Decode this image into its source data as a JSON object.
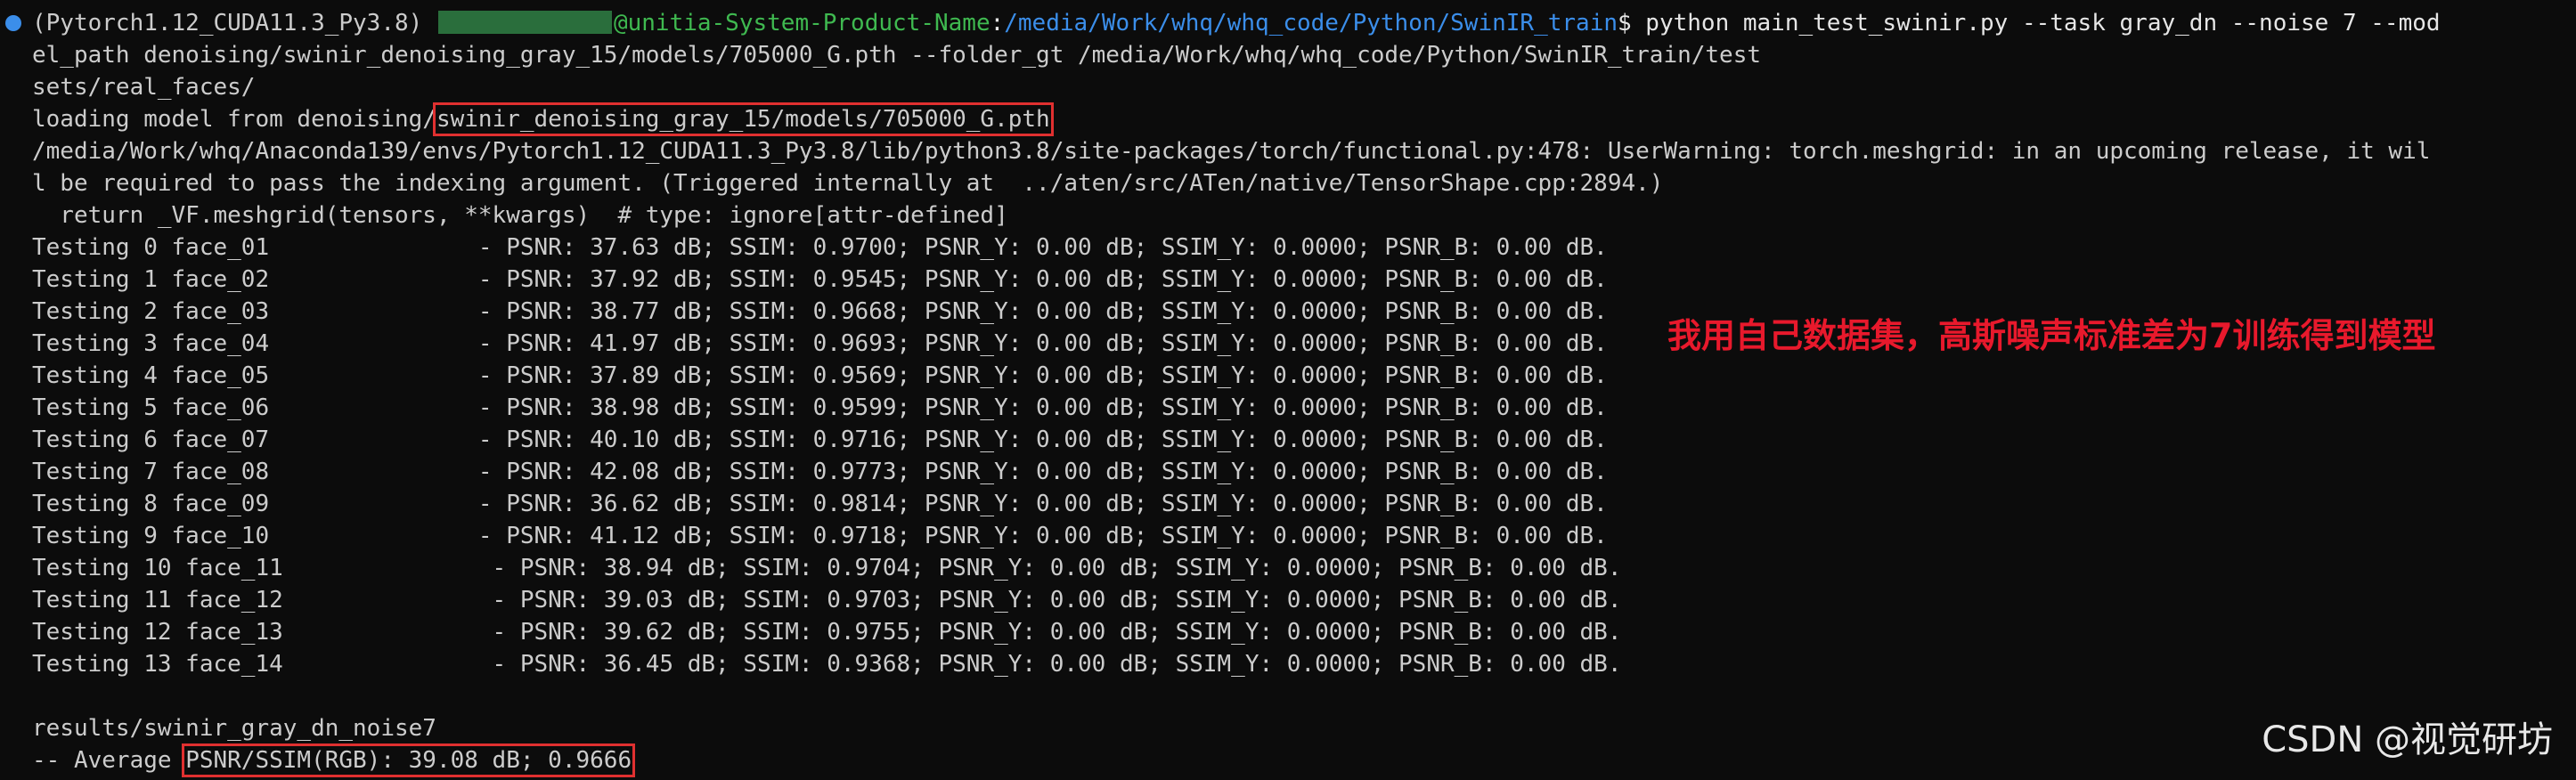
{
  "prompt": {
    "env": "(Pytorch1.12_CUDA11.3_Py3.8) ",
    "host": "@unitia-System-Product-Name",
    "path": "/media/Work/whq/whq_code/Python/SwinIR_train",
    "command": "$ python main_test_swinir.py --task gray_dn --noise 7 --mod"
  },
  "lines": {
    "l1": "el_path denoising/swinir_denoising_gray_15/models/705000_G.pth --folder_gt /media/Work/whq/whq_code/Python/SwinIR_train/test",
    "l2": "sets/real_faces/",
    "l3_prefix": "loading model from denoising/",
    "l3_boxed": "swinir_denoising_gray_15/models/705000_G.pth",
    "l4": "/media/Work/whq/Anaconda139/envs/Pytorch1.12_CUDA11.3_Py3.8/lib/python3.8/site-packages/torch/functional.py:478: UserWarning: torch.meshgrid: in an upcoming release, it wil",
    "l5": "l be required to pass the indexing argument. (Triggered internally at  ../aten/src/ATen/native/TensorShape.cpp:2894.)",
    "l6": "  return _VF.meshgrid(tensors, **kwargs)  # type: ignore[attr-defined]"
  },
  "tests": [
    "Testing 0 face_01               - PSNR: 37.63 dB; SSIM: 0.9700; PSNR_Y: 0.00 dB; SSIM_Y: 0.0000; PSNR_B: 0.00 dB.",
    "Testing 1 face_02               - PSNR: 37.92 dB; SSIM: 0.9545; PSNR_Y: 0.00 dB; SSIM_Y: 0.0000; PSNR_B: 0.00 dB.",
    "Testing 2 face_03               - PSNR: 38.77 dB; SSIM: 0.9668; PSNR_Y: 0.00 dB; SSIM_Y: 0.0000; PSNR_B: 0.00 dB.",
    "Testing 3 face_04               - PSNR: 41.97 dB; SSIM: 0.9693; PSNR_Y: 0.00 dB; SSIM_Y: 0.0000; PSNR_B: 0.00 dB.",
    "Testing 4 face_05               - PSNR: 37.89 dB; SSIM: 0.9569; PSNR_Y: 0.00 dB; SSIM_Y: 0.0000; PSNR_B: 0.00 dB.",
    "Testing 5 face_06               - PSNR: 38.98 dB; SSIM: 0.9599; PSNR_Y: 0.00 dB; SSIM_Y: 0.0000; PSNR_B: 0.00 dB.",
    "Testing 6 face_07               - PSNR: 40.10 dB; SSIM: 0.9716; PSNR_Y: 0.00 dB; SSIM_Y: 0.0000; PSNR_B: 0.00 dB.",
    "Testing 7 face_08               - PSNR: 42.08 dB; SSIM: 0.9773; PSNR_Y: 0.00 dB; SSIM_Y: 0.0000; PSNR_B: 0.00 dB.",
    "Testing 8 face_09               - PSNR: 36.62 dB; SSIM: 0.9814; PSNR_Y: 0.00 dB; SSIM_Y: 0.0000; PSNR_B: 0.00 dB.",
    "Testing 9 face_10               - PSNR: 41.12 dB; SSIM: 0.9718; PSNR_Y: 0.00 dB; SSIM_Y: 0.0000; PSNR_B: 0.00 dB.",
    "Testing 10 face_11               - PSNR: 38.94 dB; SSIM: 0.9704; PSNR_Y: 0.00 dB; SSIM_Y: 0.0000; PSNR_B: 0.00 dB.",
    "Testing 11 face_12               - PSNR: 39.03 dB; SSIM: 0.9703; PSNR_Y: 0.00 dB; SSIM_Y: 0.0000; PSNR_B: 0.00 dB.",
    "Testing 12 face_13               - PSNR: 39.62 dB; SSIM: 0.9755; PSNR_Y: 0.00 dB; SSIM_Y: 0.0000; PSNR_B: 0.00 dB.",
    "Testing 13 face_14               - PSNR: 36.45 dB; SSIM: 0.9368; PSNR_Y: 0.00 dB; SSIM_Y: 0.0000; PSNR_B: 0.00 dB."
  ],
  "results": {
    "dir": "results/swinir_gray_dn_noise7",
    "avg_prefix": "-- Average ",
    "avg_boxed": "PSNR/SSIM(RGB): 39.08 dB; 0.9666"
  },
  "annotation": "我用自己数据集，高斯噪声标准差为7训练得到模型",
  "watermark": "CSDN @视觉研坊",
  "colors": {
    "background": "#0c0c0c",
    "text": "#cccccc",
    "host": "#3fb950",
    "path": "#3b8eea",
    "highlight_box": "#e03030",
    "annotation": "#e8192c"
  }
}
